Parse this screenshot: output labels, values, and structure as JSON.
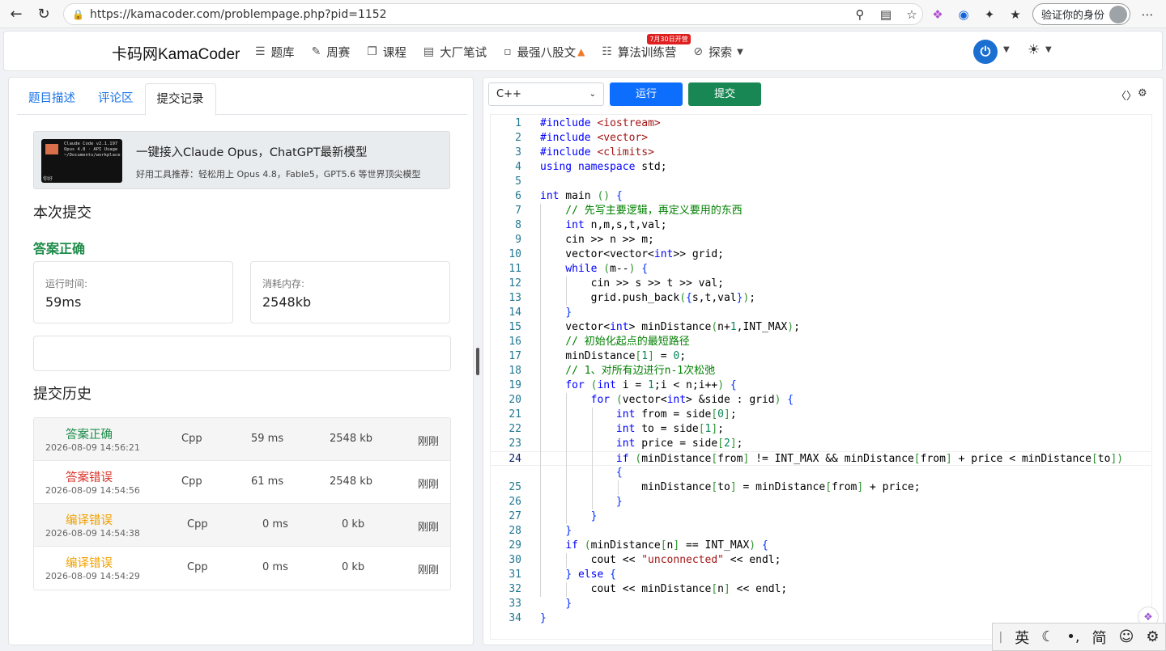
{
  "browser": {
    "url": "https://kamacoder.com/problempage.php?pid=1152",
    "profile_label": "验证你的身份"
  },
  "header": {
    "brand": "卡码网KamaCoder",
    "menu": [
      {
        "label": "题库",
        "icon": "list-icon"
      },
      {
        "label": "周赛",
        "icon": "pencil-icon"
      },
      {
        "label": "课程",
        "icon": "copy-icon"
      },
      {
        "label": "大厂笔试",
        "icon": "doc-icon"
      },
      {
        "label": "最强八股文",
        "icon": "file-icon"
      },
      {
        "label": "算法训练营",
        "icon": "calendar-icon"
      },
      {
        "label": "探索",
        "icon": "compass-icon"
      }
    ],
    "badge": "7月30日开营",
    "accent": "#1a6fd1"
  },
  "left": {
    "tabs": [
      "题目描述",
      "评论区",
      "提交记录"
    ],
    "active_tab": 2,
    "ad": {
      "title": "一键接入Claude Opus，ChatGPT最新模型",
      "subtitle": "好用工具推荐：轻松用上 Opus 4.8，Fable5，GPT5.6 等世界顶尖模型",
      "thumb_lines": [
        "Claude Code v2.1.197",
        "Opus 4.8 · API Usage",
        "~/Documents/workplace"
      ],
      "thumb_footer": "你好"
    },
    "current_title": "本次提交",
    "verdict": "答案正确",
    "runtime_label": "运行时间:",
    "runtime_value": "59ms",
    "memory_label": "消耗内存:",
    "memory_value": "2548kb",
    "history_title": "提交历史",
    "history": [
      {
        "status": "答案正确",
        "kind": "ok",
        "date": "2026-08-09 14:56:21",
        "lang": "Cpp",
        "time": "59 ms",
        "mem": "2548 kb",
        "when": "刚刚"
      },
      {
        "status": "答案错误",
        "kind": "wa",
        "date": "2026-08-09 14:54:56",
        "lang": "Cpp",
        "time": "61 ms",
        "mem": "2548 kb",
        "when": "刚刚"
      },
      {
        "status": "编译错误",
        "kind": "ce",
        "date": "2026-08-09 14:54:38",
        "lang": "Cpp",
        "time": "0 ms",
        "mem": "0 kb",
        "when": "刚刚"
      },
      {
        "status": "编译错误",
        "kind": "ce",
        "date": "2026-08-09 14:54:29",
        "lang": "Cpp",
        "time": "0 ms",
        "mem": "0 kb",
        "when": "刚刚"
      }
    ],
    "colors": {
      "ok": "#1e8c4a",
      "wa": "#d9362b",
      "ce": "#f0a000"
    }
  },
  "right": {
    "language": "C++",
    "run_label": "运行",
    "submit_label": "提交",
    "active_line": 24,
    "code": [
      "#include <iostream>",
      "#include <vector>",
      "#include <climits>",
      "using namespace std;",
      "",
      "int main () {",
      "    // 先写主要逻辑，再定义要用的东西",
      "    int n,m,s,t,val;",
      "    cin >> n >> m;",
      "    vector<vector<int>> grid;",
      "    while (m--) {",
      "        cin >> s >> t >> val;",
      "        grid.push_back({s,t,val});",
      "    }",
      "    vector<int> minDistance(n+1,INT_MAX);",
      "    // 初始化起点的最短路径",
      "    minDistance[1] = 0;",
      "    // 1、对所有边进行n-1次松弛",
      "    for (int i = 1;i < n;i++) {",
      "        for (vector<int> &side : grid) {",
      "            int from = side[0];",
      "            int to = side[1];",
      "            int price = side[2];",
      "            if (minDistance[from] != INT_MAX && minDistance[from] + price < minDistance[to])",
      "            {",
      "                minDistance[to] = minDistance[from] + price;",
      "            }",
      "        }",
      "    }",
      "    if (minDistance[n] == INT_MAX) {",
      "        cout << \"unconnected\" << endl;",
      "    } else {",
      "        cout << minDistance[n] << endl;",
      "    }",
      "}"
    ],
    "line_numbers": [
      "1",
      "2",
      "3",
      "4",
      "5",
      "6",
      "7",
      "8",
      "9",
      "10",
      "11",
      "12",
      "13",
      "14",
      "15",
      "16",
      "17",
      "18",
      "19",
      "20",
      "21",
      "22",
      "23",
      "24",
      "",
      "25",
      "26",
      "27",
      "28",
      "29",
      "30",
      "31",
      "32",
      "33",
      "34"
    ]
  },
  "ime": [
    "英",
    "简"
  ]
}
